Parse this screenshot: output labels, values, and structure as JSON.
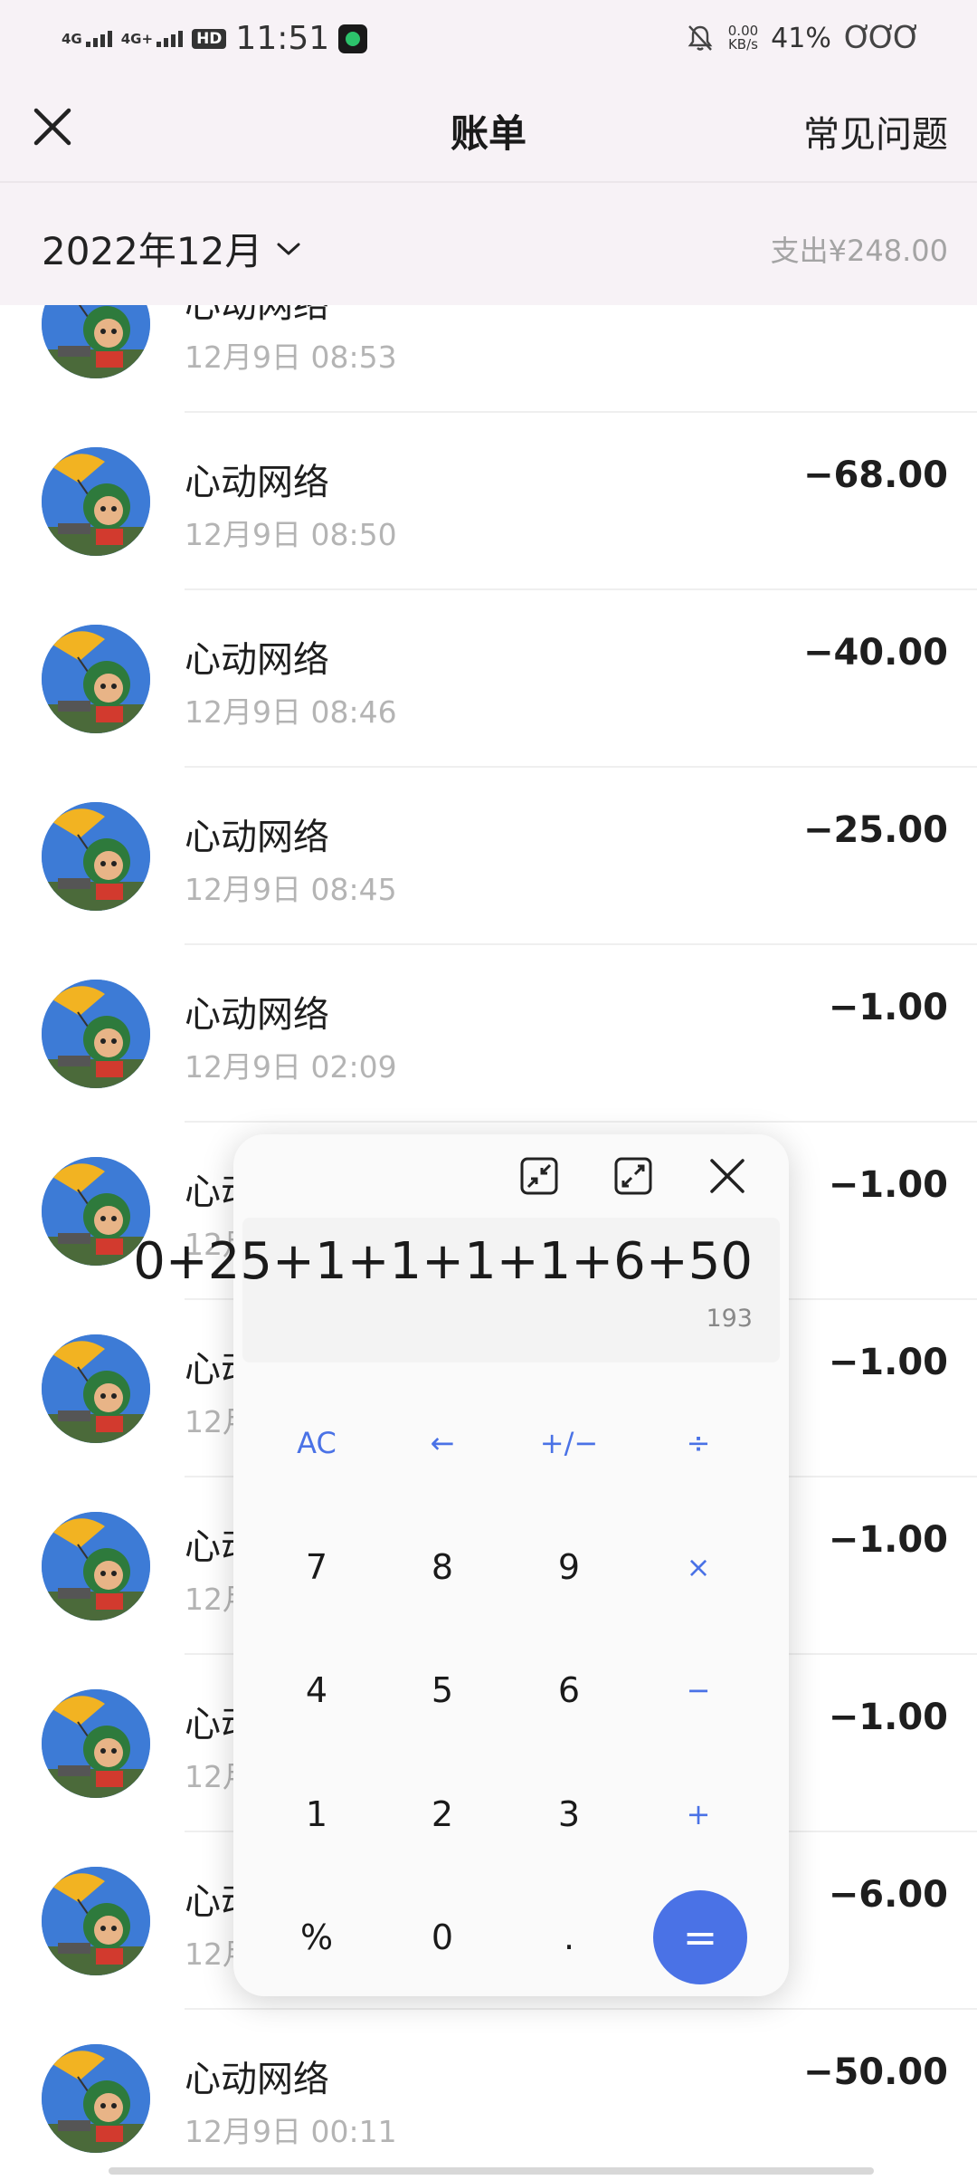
{
  "status_bar": {
    "net1": "4G",
    "net2": "4G+",
    "hd": "HD",
    "time": "11:51",
    "speed_value": "0.00",
    "speed_unit": "KB/s",
    "battery": "41%",
    "battery_icons": "ƠƠƠ"
  },
  "nav": {
    "title": "账单",
    "faq": "常见问题"
  },
  "month_bar": {
    "month": "2022年12月",
    "summary": "支出¥248.00"
  },
  "records": [
    {
      "merchant": "心动网络",
      "time": "12月9日 08:53",
      "amount": ""
    },
    {
      "merchant": "心动网络",
      "time": "12月9日 08:50",
      "amount": "−68.00"
    },
    {
      "merchant": "心动网络",
      "time": "12月9日 08:46",
      "amount": "−40.00"
    },
    {
      "merchant": "心动网络",
      "time": "12月9日 08:45",
      "amount": "−25.00"
    },
    {
      "merchant": "心动网络",
      "time": "12月9日 02:09",
      "amount": "−1.00"
    },
    {
      "merchant": "心动网络",
      "time": "12月",
      "amount": "−1.00"
    },
    {
      "merchant": "心动网络",
      "time": "12月",
      "amount": "−1.00"
    },
    {
      "merchant": "心动网络",
      "time": "12月",
      "amount": "−1.00"
    },
    {
      "merchant": "心动网络",
      "time": "12月",
      "amount": "−1.00"
    },
    {
      "merchant": "心动网络",
      "time": "12月",
      "amount": "−6.00"
    },
    {
      "merchant": "心动网络",
      "time": "12月9日 00:11",
      "amount": "−50.00"
    }
  ],
  "calculator": {
    "expression": "0+25+1+1+1+1+6+50",
    "result": "193",
    "keys": {
      "ac": "AC",
      "back": "←",
      "sign": "+/−",
      "divide": "÷",
      "seven": "7",
      "eight": "8",
      "nine": "9",
      "multiply": "×",
      "four": "4",
      "five": "5",
      "six": "6",
      "minus": "−",
      "one": "1",
      "two": "2",
      "three": "3",
      "plus": "+",
      "percent": "%",
      "zero": "0",
      "dot": ".",
      "equals": "="
    }
  },
  "colors": {
    "accent": "#4a72e6",
    "header_bg": "#f7f2f6"
  }
}
